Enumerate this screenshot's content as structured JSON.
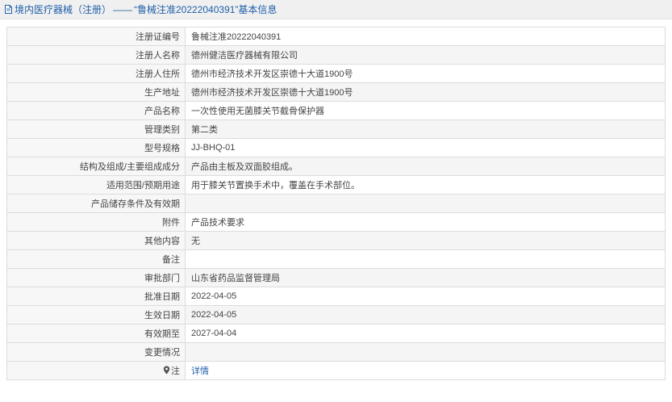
{
  "header": {
    "crumb_root": "境内医疗器械（注册）",
    "separator": "——",
    "title": "“鲁械注准20222040391”基本信息"
  },
  "rows": [
    {
      "label": "注册证编号",
      "value": "鲁械注准20222040391"
    },
    {
      "label": "注册人名称",
      "value": "德州健洁医疗器械有限公司"
    },
    {
      "label": "注册人住所",
      "value": "德州市经济技术开发区崇德十大道1900号"
    },
    {
      "label": "生产地址",
      "value": "德州市经济技术开发区崇德十大道1900号"
    },
    {
      "label": "产品名称",
      "value": "一次性使用无菌膝关节截骨保护器"
    },
    {
      "label": "管理类别",
      "value": "第二类"
    },
    {
      "label": "型号规格",
      "value": "JJ-BHQ-01"
    },
    {
      "label": "结构及组成/主要组成成分",
      "value": "产品由主板及双面胶组成。"
    },
    {
      "label": "适用范围/预期用途",
      "value": "用于膝关节置换手术中，覆盖在手术部位。"
    },
    {
      "label": "产品储存条件及有效期",
      "value": ""
    },
    {
      "label": "附件",
      "value": "产品技术要求"
    },
    {
      "label": "其他内容",
      "value": "无"
    },
    {
      "label": "备注",
      "value": ""
    },
    {
      "label": "审批部门",
      "value": "山东省药品监督管理局"
    },
    {
      "label": "批准日期",
      "value": "2022-04-05"
    },
    {
      "label": "生效日期",
      "value": "2022-04-05"
    },
    {
      "label": "有效期至",
      "value": "2027-04-04"
    },
    {
      "label": "变更情况",
      "value": ""
    }
  ],
  "note_row": {
    "label": "注",
    "icon": "map-pin-icon",
    "link_text": "详情"
  },
  "colors": {
    "link": "#1e5fa8",
    "label_bg": "#f7f7f7",
    "stripe_bg": "#f5f5f5",
    "border": "#dcdcdc"
  }
}
